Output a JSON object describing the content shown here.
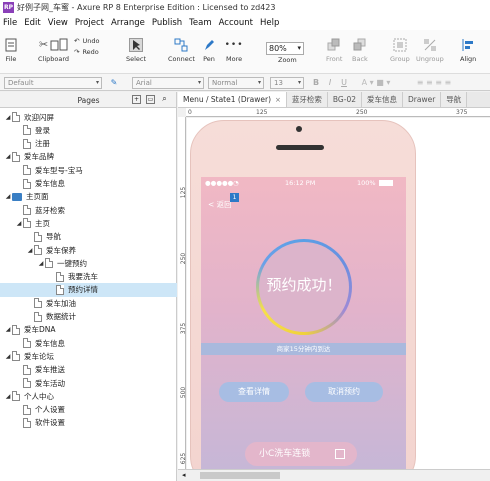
{
  "window": {
    "title": "好例子网_车蜜 - Axure RP 8 Enterprise Edition : Licensed to zd423",
    "app_icon": "RP"
  },
  "menu": [
    "File",
    "Edit",
    "View",
    "Project",
    "Arrange",
    "Publish",
    "Team",
    "Account",
    "Help"
  ],
  "toolbar": {
    "file": "File",
    "clipboard": "Clipboard",
    "undo": "Undo",
    "redo": "Redo",
    "select": "Select",
    "connect": "Connect",
    "pen": "Pen",
    "more": "More",
    "zoom_label": "Zoom",
    "zoom_value": "80%",
    "front": "Front",
    "back": "Back",
    "group": "Group",
    "ungroup": "Ungroup",
    "align": "Align"
  },
  "stylebar": {
    "style": "Default",
    "font": "Arial",
    "weight": "Normal",
    "size": "13",
    "bold": "B",
    "italic": "I",
    "underline": "U"
  },
  "pages": {
    "header": "Pages",
    "items": [
      {
        "label": "欢迎闪屏",
        "depth": 0,
        "expanded": true,
        "type": "page"
      },
      {
        "label": "登录",
        "depth": 1,
        "type": "page"
      },
      {
        "label": "注册",
        "depth": 1,
        "type": "page"
      },
      {
        "label": "爱车品牌",
        "depth": 0,
        "expanded": true,
        "type": "page"
      },
      {
        "label": "爱车型号-宝马",
        "depth": 1,
        "type": "page"
      },
      {
        "label": "爱车信息",
        "depth": 1,
        "type": "page"
      },
      {
        "label": "主页面",
        "depth": 0,
        "expanded": true,
        "type": "folder"
      },
      {
        "label": "蓝牙检索",
        "depth": 1,
        "type": "page"
      },
      {
        "label": "主页",
        "depth": 1,
        "expanded": true,
        "type": "page"
      },
      {
        "label": "导航",
        "depth": 2,
        "type": "page"
      },
      {
        "label": "爱车保养",
        "depth": 2,
        "expanded": true,
        "type": "page"
      },
      {
        "label": "一键预约",
        "depth": 3,
        "expanded": true,
        "type": "page"
      },
      {
        "label": "我要洗车",
        "depth": 4,
        "type": "page"
      },
      {
        "label": "预约详情",
        "depth": 4,
        "type": "page",
        "selected": true
      },
      {
        "label": "爱车加油",
        "depth": 2,
        "type": "page"
      },
      {
        "label": "数据统计",
        "depth": 2,
        "type": "page"
      },
      {
        "label": "爱车DNA",
        "depth": 0,
        "expanded": true,
        "type": "page"
      },
      {
        "label": "爱车信息",
        "depth": 1,
        "type": "page"
      },
      {
        "label": "爱车论坛",
        "depth": 0,
        "expanded": true,
        "type": "page"
      },
      {
        "label": "爱车推送",
        "depth": 1,
        "type": "page"
      },
      {
        "label": "爱车活动",
        "depth": 1,
        "type": "page"
      },
      {
        "label": "个人中心",
        "depth": 0,
        "expanded": true,
        "type": "page"
      },
      {
        "label": "个人设置",
        "depth": 1,
        "type": "page"
      },
      {
        "label": "软件设置",
        "depth": 1,
        "type": "page"
      }
    ]
  },
  "tabs": [
    "Menu / State1 (Drawer)",
    "蓝牙检索",
    "BG-02",
    "爱车信息",
    "Drawer",
    "导航"
  ],
  "ruler": {
    "h": [
      "0",
      "125",
      "250",
      "375"
    ],
    "v": [
      "125",
      "250",
      "375",
      "500",
      "625"
    ]
  },
  "phone": {
    "status_signal": "●●●●● ",
    "status_time": "16:12 PM",
    "status_battery": "100%",
    "back": "< 返回",
    "badge": "1",
    "success": "预约成功！",
    "banner": "商家15分钟内到达",
    "btn_detail": "查看详情",
    "btn_cancel": "取消预约",
    "btn_bottom": "小C洗车连锁"
  }
}
